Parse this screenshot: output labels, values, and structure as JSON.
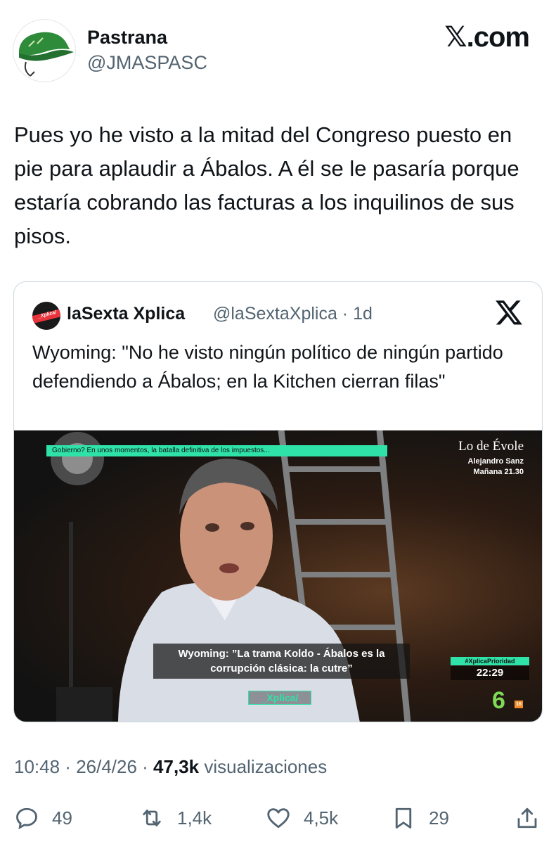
{
  "author": {
    "name": "Pastrana",
    "handle": "@JMASPASC",
    "avatar_icon": "green-cap-icon"
  },
  "brand": {
    "label": "𝕏.com"
  },
  "tweet": {
    "text": "Pues yo he visto a la mitad del Congreso puesto en pie para aplaudir a Ábalos. A él se le pasaría porque estaría cobrando las facturas a los inquilinos de sus pisos."
  },
  "quoted": {
    "name": "laSexta Xplica",
    "handle": "@laSextaXplica",
    "time": "1d",
    "avatar_text": "_Xplica/",
    "text": "Wyoming: \"No he visto ningún político de ningún partido defendiendo a Ábalos; en la Kitchen cierran filas\"",
    "video": {
      "ticker": "Gobierno? En unos momentos, la batalla definitiva de los impuestos...",
      "show_title": "Lo de Évole",
      "show_guest": "Alejandro Sanz",
      "show_time": "Mañana 21.30",
      "caption": "Wyoming: ”La trama Koldo - Ábalos es la corrupción clásica: la cutre”",
      "program_badge": "_Xplica/",
      "hashtag": "#XplicaPrioridad",
      "clock": "22:29",
      "channel": "6",
      "age_rating": "16"
    }
  },
  "meta": {
    "time": "10:48",
    "date": "26/4/26",
    "views": "47,3k",
    "views_label": "visualizaciones"
  },
  "actions": {
    "replies": "49",
    "reposts": "1,4k",
    "likes": "4,5k",
    "bookmarks": "29"
  },
  "colors": {
    "text": "#0f1419",
    "secondary": "#536471",
    "border": "#cfd9de",
    "xplica_green": "#2fe3a8",
    "cap_green": "#2e8b3a"
  }
}
